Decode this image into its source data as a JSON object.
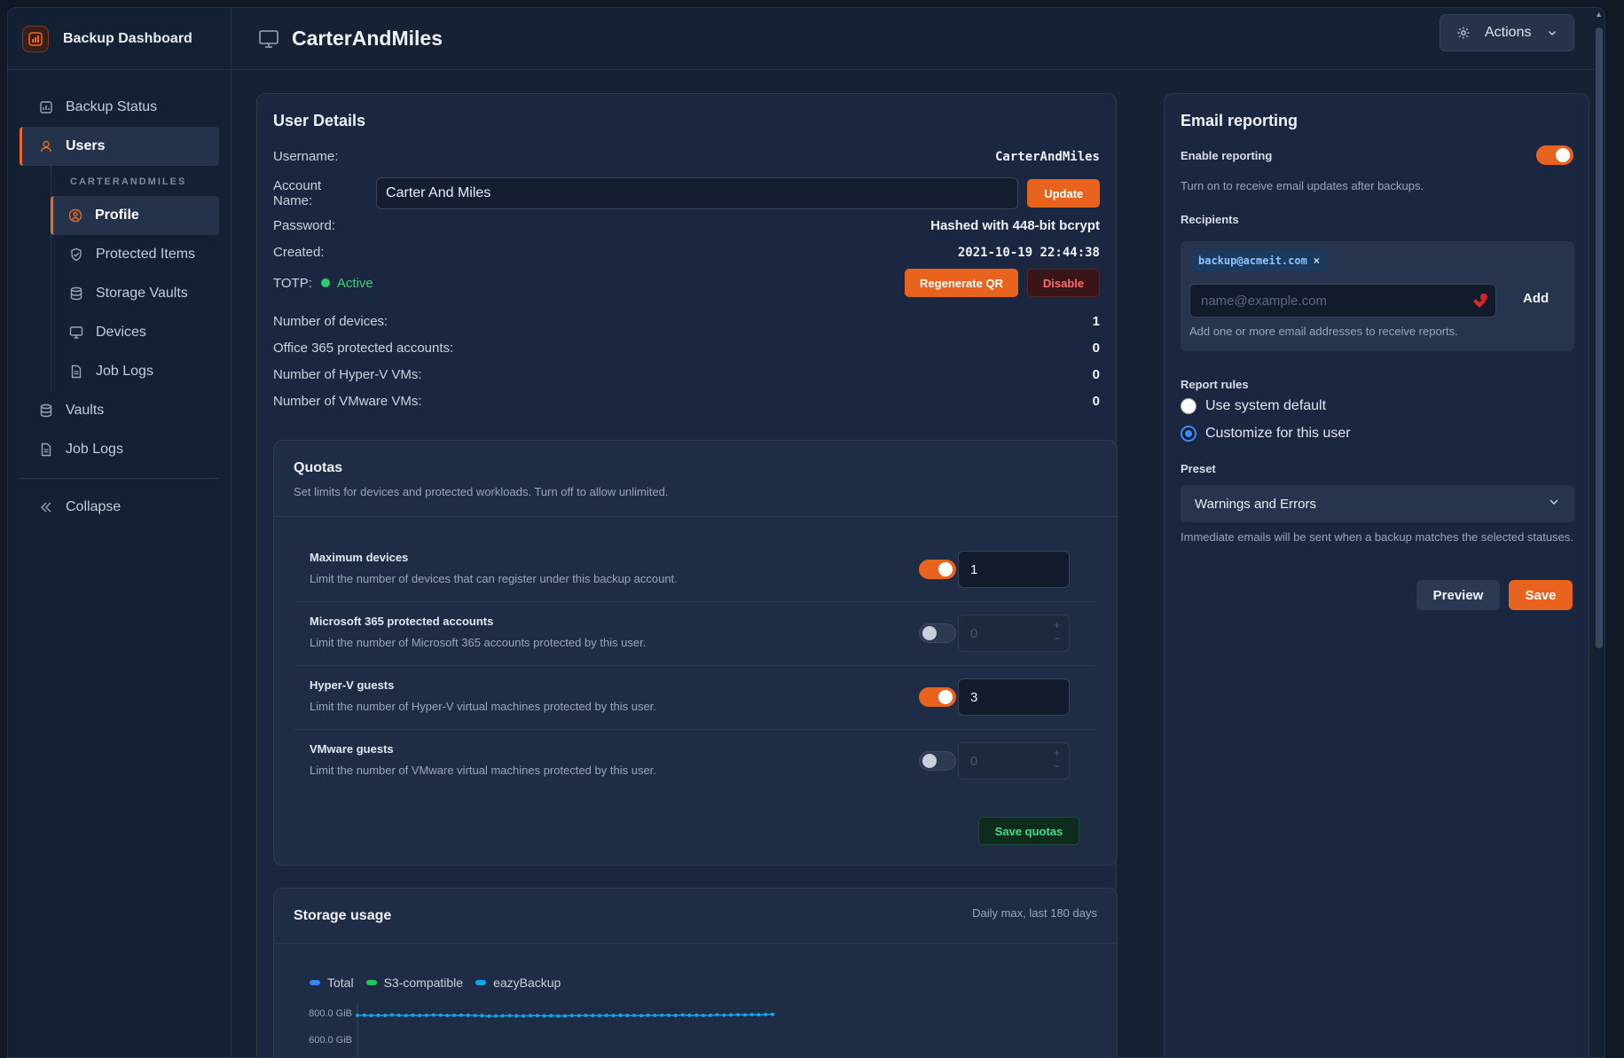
{
  "app": {
    "title": "Backup Dashboard"
  },
  "sidebar": {
    "items": [
      {
        "label": "Backup Status",
        "icon": "chart-icon"
      },
      {
        "label": "Users",
        "icon": "user-icon"
      },
      {
        "label": "Vaults",
        "icon": "database-icon"
      },
      {
        "label": "Job Logs",
        "icon": "file-icon"
      },
      {
        "label": "Collapse",
        "icon": "double-chevron-left-icon"
      }
    ],
    "sub_title": "CARTERANDMILES",
    "sub_items": [
      {
        "label": "Profile",
        "icon": "user-circle-icon"
      },
      {
        "label": "Protected Items",
        "icon": "shield-icon"
      },
      {
        "label": "Storage Vaults",
        "icon": "database-icon"
      },
      {
        "label": "Devices",
        "icon": "monitor-icon"
      },
      {
        "label": "Job Logs",
        "icon": "file-icon"
      }
    ]
  },
  "header": {
    "title": "CarterAndMiles",
    "actions_label": "Actions"
  },
  "user_details": {
    "title": "User Details",
    "username_label": "Username:",
    "username": "CarterAndMiles",
    "account_name_label": "Account Name:",
    "account_name": "Carter And Miles",
    "update_label": "Update",
    "password_label": "Password:",
    "password": "Hashed with 448-bit bcrypt",
    "created_label": "Created:",
    "created": "2021-10-19 22:44:38",
    "totp_label": "TOTP:",
    "totp_status": "Active",
    "regen_label": "Regenerate QR",
    "disable_label": "Disable",
    "stats": [
      {
        "label": "Number of devices:",
        "value": "1"
      },
      {
        "label": "Office 365 protected accounts:",
        "value": "0"
      },
      {
        "label": "Number of Hyper-V VMs:",
        "value": "0"
      },
      {
        "label": "Number of VMware VMs:",
        "value": "0"
      }
    ]
  },
  "quotas": {
    "title": "Quotas",
    "subtitle": "Set limits for devices and protected workloads. Turn off to allow unlimited.",
    "rows": [
      {
        "title": "Maximum devices",
        "desc": "Limit the number of devices that can register under this backup account.",
        "enabled": true,
        "value": "1"
      },
      {
        "title": "Microsoft 365 protected accounts",
        "desc": "Limit the number of Microsoft 365 accounts protected by this user.",
        "enabled": false,
        "value": "0"
      },
      {
        "title": "Hyper-V guests",
        "desc": "Limit the number of Hyper-V virtual machines protected by this user.",
        "enabled": true,
        "value": "3"
      },
      {
        "title": "VMware guests",
        "desc": "Limit the number of VMware virtual machines protected by this user.",
        "enabled": false,
        "value": "0"
      }
    ],
    "save_label": "Save quotas"
  },
  "storage": {
    "title": "Storage usage",
    "note": "Daily max, last 180 days",
    "legend": [
      {
        "name": "Total",
        "color": "#3b82f6"
      },
      {
        "name": "S3-compatible",
        "color": "#22c55e"
      },
      {
        "name": "eazyBackup",
        "color": "#0ea5e9"
      }
    ]
  },
  "chart_data": {
    "type": "line",
    "ylabel": "",
    "y_ticks": [
      "800.0 GiB",
      "600.0 GiB"
    ],
    "series": [
      {
        "name": "eazyBackup",
        "color": "#0ea5e9",
        "values": [
          780,
          782,
          779,
          781,
          780,
          783,
          781,
          779,
          782,
          780,
          781,
          783,
          782,
          780,
          781,
          782,
          781,
          779,
          778,
          775,
          776,
          777,
          778,
          777,
          776,
          778,
          779,
          777,
          778,
          776,
          777,
          779,
          778,
          780,
          779,
          778,
          780,
          779,
          781,
          779,
          780,
          778,
          781,
          780,
          782,
          781,
          780,
          783,
          781,
          782,
          780,
          781,
          784,
          782,
          783,
          785,
          784,
          786,
          785,
          787,
          788
        ]
      }
    ]
  },
  "email": {
    "title": "Email reporting",
    "enable_label": "Enable reporting",
    "enable_hint": "Turn on to receive email updates after backups.",
    "recipients_label": "Recipients",
    "recipient_chip": "backup@acmeit.com",
    "chip_remove": "×",
    "email_placeholder": "name@example.com",
    "add_label": "Add",
    "recipients_hint": "Add one or more email addresses to receive reports.",
    "rules_label": "Report rules",
    "rule_default": "Use system default",
    "rule_custom": "Customize for this user",
    "preset_label": "Preset",
    "preset_value": "Warnings and Errors",
    "preset_hint": "Immediate emails will be sent when a backup matches the selected statuses.",
    "preview_label": "Preview",
    "save_label": "Save"
  },
  "colors": {
    "accent": "#e8641e",
    "success": "#2ecc71",
    "link": "#3b8cff"
  }
}
